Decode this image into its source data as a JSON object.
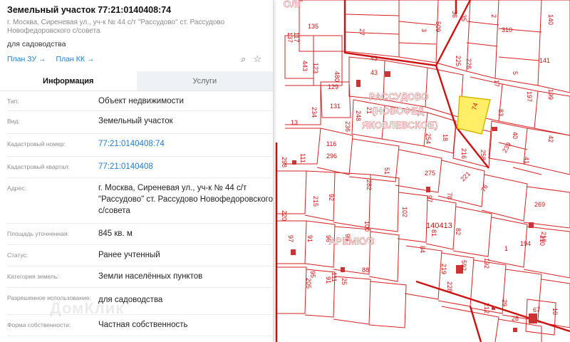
{
  "panel": {
    "title": "Земельный участок 77:21:0140408:74",
    "address_short": "г. Москва, Сиреневая ул., уч-к № 44 с/т \"Рассудово\" ст. Рассудово Новофедоровского с/совета",
    "usage": "для садоводства",
    "links": {
      "plan_zu": "План ЗУ",
      "plan_kk": "План КК"
    },
    "tabs": {
      "info": "Информация",
      "services": "Услуги"
    },
    "rows": [
      {
        "key": "Тип:",
        "value": "Объект недвижимости"
      },
      {
        "key": "Вид:",
        "value": "Земельный участок"
      },
      {
        "key": "Кадастровый номер:",
        "value": "77:21:0140408:74"
      },
      {
        "key": "Кадастровый квартал:",
        "value": "77:21:0140408"
      },
      {
        "key": "Адрес:",
        "value": "г. Москва, Сиреневая ул., уч-к № 44 с/т \"Рассудово\" ст. Рассудово Новофедоровского с/совета"
      },
      {
        "key": "Площадь уточненная:",
        "value": "845 кв. м"
      },
      {
        "key": "Статус:",
        "value": "Ранее учтенный"
      },
      {
        "key": "Категория земель:",
        "value": "Земли населённых пунктов"
      },
      {
        "key": "Разрешенное использование:",
        "value": "для садоводства"
      },
      {
        "key": "Форма собственности:",
        "value": "Частная собственность"
      }
    ],
    "watermark": "ДомКлик"
  },
  "map": {
    "place_lines": [
      "РАССУДОВО",
      "(НОВОФЕД",
      "ЯКОВЛЕВСКОЕ)"
    ],
    "place2": "АРЕМКУЗ",
    "quarter": "140413",
    "top_label": "ОЛГ",
    "plot_numbers": [
      "117",
      "137",
      "135",
      "27",
      "3",
      "509",
      "36",
      "35",
      "310",
      "2",
      "140",
      "141",
      "199",
      "197",
      "443",
      "123",
      "480",
      "43",
      "43",
      "226",
      "225",
      "17",
      "5",
      "129",
      "131",
      "248",
      "21",
      "236",
      "234",
      "74",
      "83",
      "40",
      "13",
      "298",
      "111",
      "116",
      "296",
      "254",
      "18",
      "216",
      "258",
      "239",
      "41",
      "42",
      "275",
      "215",
      "92",
      "282",
      "51",
      "221",
      "97",
      "76",
      "78",
      "269",
      "220",
      "91",
      "96",
      "99",
      "100",
      "102",
      "140413",
      "81",
      "82",
      "210",
      "97",
      "95",
      "111",
      "84",
      "592",
      "192",
      "1",
      "194",
      "210",
      "219",
      "25",
      "88",
      "228",
      "212",
      "29",
      "28",
      "67",
      "10",
      "205",
      "91",
      "90"
    ],
    "colors": {
      "line": "#cc1111",
      "highlight": "#ffee66",
      "building": "#cc3333"
    }
  }
}
